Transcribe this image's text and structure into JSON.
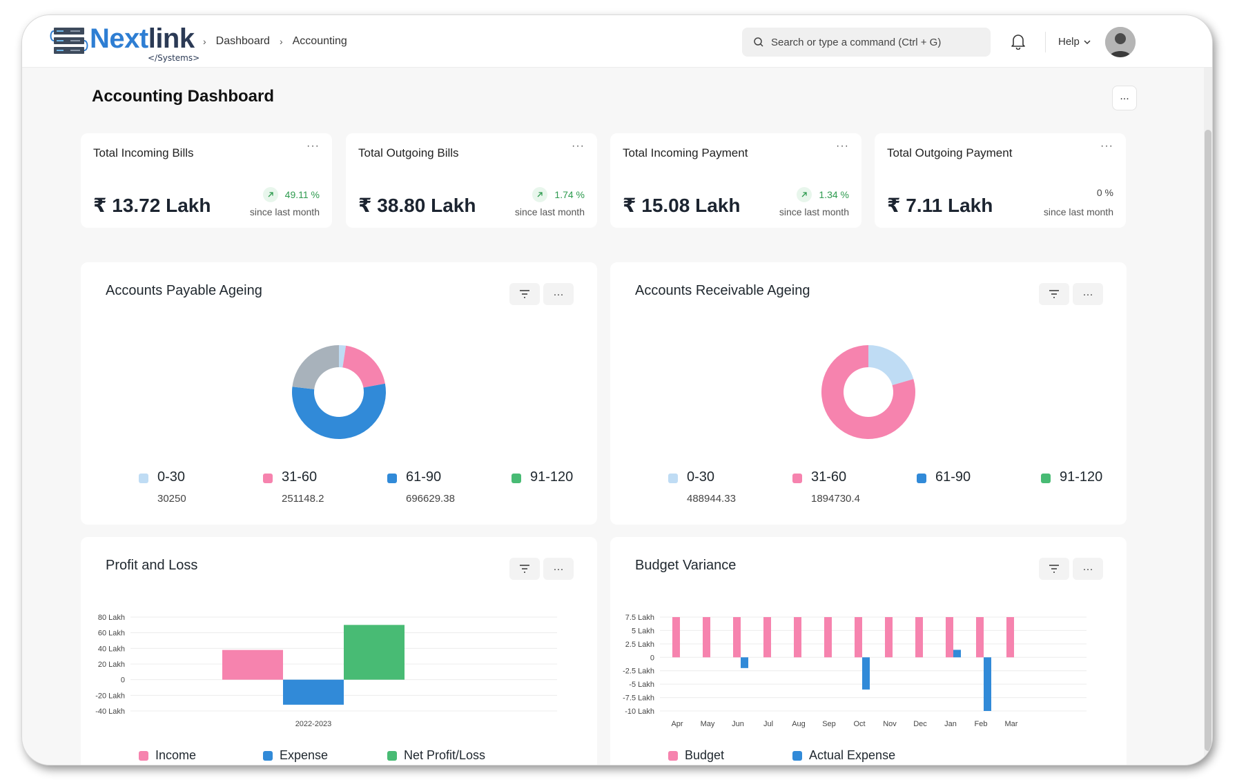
{
  "app": {
    "logo_main_a": "Next",
    "logo_main_b": "link",
    "logo_sub": "</Systems>"
  },
  "breadcrumb": [
    "Dashboard",
    "Accounting"
  ],
  "search": {
    "placeholder": "Search or type a command (Ctrl + G)"
  },
  "header": {
    "help_label": "Help"
  },
  "page": {
    "title": "Accounting Dashboard",
    "menu_label": "..."
  },
  "kpis": [
    {
      "title": "Total Incoming Bills",
      "value": "₹ 13.72 Lakh",
      "delta": "49.11 %",
      "trend": "up",
      "since": "since last month"
    },
    {
      "title": "Total Outgoing Bills",
      "value": "₹ 38.80 Lakh",
      "delta": "1.74 %",
      "trend": "up",
      "since": "since last month"
    },
    {
      "title": "Total Incoming Payment",
      "value": "₹ 15.08 Lakh",
      "delta": "1.34 %",
      "trend": "up",
      "since": "since last month"
    },
    {
      "title": "Total Outgoing Payment",
      "value": "₹ 7.11 Lakh",
      "delta": "0 %",
      "trend": "neutral",
      "since": "since last month"
    }
  ],
  "colors": {
    "c0_30": "#bfdcf4",
    "c31_60": "#f683ae",
    "c61_90": "#318ad8",
    "c91_120": "#48bb74",
    "other": "#a8b2bb",
    "positive": "#2d9a4e"
  },
  "panels": {
    "payable": {
      "title": "Accounts Payable Ageing"
    },
    "receivable": {
      "title": "Accounts Receivable Ageing"
    },
    "pnl": {
      "title": "Profit and Loss"
    },
    "budget": {
      "title": "Budget Variance"
    }
  },
  "chart_data": [
    {
      "type": "pie",
      "title": "Accounts Payable Ageing",
      "categories": [
        "0-30",
        "31-60",
        "61-90",
        "91-120",
        ""
      ],
      "values": [
        30250,
        251148.2,
        696629.38,
        0,
        295000
      ],
      "value_labels": [
        "30250",
        "251148.2",
        "696629.38",
        "",
        ""
      ],
      "colors": [
        "#bfdcf4",
        "#f683ae",
        "#318ad8",
        "#48bb74",
        "#a8b2bb"
      ],
      "legend": "bottom"
    },
    {
      "type": "pie",
      "title": "Accounts Receivable Ageing",
      "categories": [
        "0-30",
        "31-60",
        "61-90",
        "91-120"
      ],
      "values": [
        488944.33,
        1894730.4,
        0,
        0
      ],
      "value_labels": [
        "488944.33",
        "1894730.4",
        "",
        ""
      ],
      "colors": [
        "#bfdcf4",
        "#f683ae",
        "#318ad8",
        "#48bb74"
      ],
      "legend": "bottom"
    },
    {
      "type": "bar",
      "title": "Profit and Loss",
      "categories": [
        "2022-2023"
      ],
      "series": [
        {
          "name": "Income",
          "values": [
            38
          ],
          "color": "#f683ae"
        },
        {
          "name": "Expense",
          "values": [
            -32
          ],
          "color": "#318ad8"
        },
        {
          "name": "Net Profit/Loss",
          "values": [
            70
          ],
          "color": "#48bb74"
        }
      ],
      "ylim": [
        -40,
        80
      ],
      "yticks": [
        80,
        60,
        40,
        20,
        0,
        -20,
        -40
      ],
      "ytick_labels": [
        "80 Lakh",
        "60 Lakh",
        "40 Lakh",
        "20 Lakh",
        "0",
        "-20 Lakh",
        "-40 Lakh"
      ],
      "grid": true,
      "legend": "bottom"
    },
    {
      "type": "bar",
      "title": "Budget Variance",
      "categories": [
        "Apr",
        "May",
        "Jun",
        "Jul",
        "Aug",
        "Sep",
        "Oct",
        "Nov",
        "Dec",
        "Jan",
        "Feb",
        "Mar"
      ],
      "series": [
        {
          "name": "Budget",
          "values": [
            7.5,
            7.5,
            7.5,
            7.5,
            7.5,
            7.5,
            7.5,
            7.5,
            7.5,
            7.5,
            7.5,
            7.5
          ],
          "color": "#f683ae"
        },
        {
          "name": "Actual Expense",
          "values": [
            0,
            0,
            -2,
            0,
            0,
            0,
            -6,
            0,
            0,
            1.4,
            -10,
            0
          ],
          "color": "#318ad8"
        }
      ],
      "ylim": [
        -10,
        7.5
      ],
      "yticks": [
        7.5,
        5,
        2.5,
        0,
        -2.5,
        -5,
        -7.5,
        -10
      ],
      "ytick_labels": [
        "7.5 Lakh",
        "5 Lakh",
        "2.5 Lakh",
        "0",
        "-2.5 Lakh",
        "-5 Lakh",
        "-7.5 Lakh",
        "-10 Lakh"
      ],
      "grid": true,
      "legend": "bottom"
    }
  ]
}
